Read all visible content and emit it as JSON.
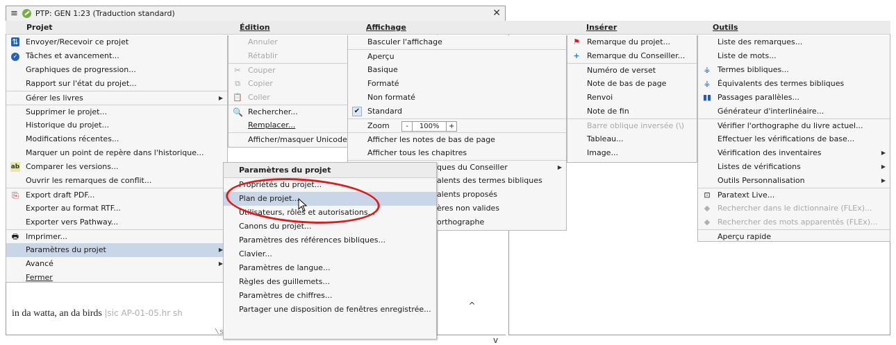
{
  "window": {
    "title": "PTP: GEN 1:23 (Traduction standard)",
    "close_glyph": "✕",
    "document_text": "in da watta, an da birds",
    "document_ref": "|sic  AP-01-05.hr  sh",
    "marker_text": "\\s2 [",
    "scroll_up": "^",
    "scroll_down": "v"
  },
  "menubar": {
    "projet": "Projet",
    "edition": "Édition",
    "affichage": "Affichage",
    "inserer": "Insérer",
    "outils": "Outils"
  },
  "projet_menu": [
    {
      "label": "Envoyer/Recevoir ce projet",
      "icon": "send-receive-icon"
    },
    {
      "label": "Tâches et avancement...",
      "icon": "tasks-icon"
    },
    {
      "label": "Graphiques de progression..."
    },
    {
      "label": "Rapport sur l'état du projet..."
    },
    {
      "label": "Gérer les livres",
      "submenu": true
    },
    {
      "label": "Supprimer le projet..."
    },
    {
      "label": "Historique du projet..."
    },
    {
      "label": "Modifications récentes..."
    },
    {
      "label": "Marquer un point de repère dans l'historique..."
    },
    {
      "label": "Comparer les versions...",
      "icon": "compare-icon"
    },
    {
      "label": "Ouvrir les remarques de conflit..."
    },
    {
      "label": "Export draft PDF...",
      "icon": "pdf-icon"
    },
    {
      "label": "Exporter au format RTF..."
    },
    {
      "label": "Exporter vers Pathway..."
    },
    {
      "label": "Imprimer...",
      "icon": "printer-icon"
    },
    {
      "label": "Paramètres du projet",
      "submenu": true,
      "highlighted": true
    },
    {
      "label": "Avancé",
      "submenu": true
    },
    {
      "label": "Fermer"
    }
  ],
  "edition_menu": [
    {
      "label": "Annuler",
      "disabled": true
    },
    {
      "label": "Rétablir",
      "disabled": true
    },
    {
      "label": "Couper",
      "disabled": true,
      "icon": "scissors-icon"
    },
    {
      "label": "Copier",
      "disabled": true,
      "icon": "copy-icon"
    },
    {
      "label": "Coller",
      "disabled": true,
      "icon": "paste-icon"
    },
    {
      "label": "Rechercher...",
      "icon": "search-icon"
    },
    {
      "label": "Remplacer..."
    },
    {
      "label": "Afficher/masquer Unicode"
    }
  ],
  "affichage_menu": {
    "items_top": [
      {
        "label": "Basculer l'affichage"
      },
      {
        "label": "Aperçu"
      },
      {
        "label": "Basique"
      },
      {
        "label": "Formaté"
      },
      {
        "label": "Non formaté"
      },
      {
        "label": "Standard",
        "checked": true
      }
    ],
    "zoom_label": "Zoom",
    "zoom_minus": "-",
    "zoom_value": "100%",
    "zoom_plus": "+",
    "items_bottom": [
      {
        "label": "Afficher les notes de bas de page"
      },
      {
        "label": "Afficher tous les chapitres"
      },
      {
        "label": "ques du Conseiller",
        "submenu": true
      },
      {
        "label": "alents des termes bibliques"
      },
      {
        "label": "alents proposés"
      },
      {
        "label": "ères non valides"
      },
      {
        "label": "orthographe"
      }
    ]
  },
  "inserer_menu": [
    {
      "label": "Remarque du projet...",
      "icon": "red-flag-icon"
    },
    {
      "label": "Remarque du Conseiller...",
      "icon": "blue-cross-icon"
    },
    {
      "label": "Numéro de verset"
    },
    {
      "label": "Note de bas de page"
    },
    {
      "label": "Renvoi"
    },
    {
      "label": "Note de fin"
    },
    {
      "label": "Barre oblique inversée (\\)",
      "disabled": true
    },
    {
      "label": "Tableau..."
    },
    {
      "label": "Image..."
    }
  ],
  "outils_menu": [
    {
      "label": "Liste des remarques..."
    },
    {
      "label": "Liste de mots..."
    },
    {
      "label": "Termes bibliques...",
      "icon": "biblical-terms-icon"
    },
    {
      "label": "Équivalents des termes bibliques",
      "icon": "biblical-terms-icon"
    },
    {
      "label": "Passages parallèles...",
      "icon": "parallel-passages-icon"
    },
    {
      "label": "Générateur d'interlinéaire..."
    },
    {
      "label": "Vérifier l'orthographe du livre actuel..."
    },
    {
      "label": "Effectuer les vérifications de base..."
    },
    {
      "label": "Vérification des inventaires",
      "submenu": true
    },
    {
      "label": "Listes de vérifications",
      "submenu": true
    },
    {
      "label": "Outils Personnalisation",
      "submenu": true
    },
    {
      "label": "Paratext Live...",
      "icon": "paratext-live-icon"
    },
    {
      "label": "Rechercher dans le dictionnaire (FLEx)...",
      "disabled": true,
      "icon": "flex-icon"
    },
    {
      "label": "Rechercher des mots apparentés (FLEx)...",
      "disabled": true,
      "icon": "flex-icon"
    },
    {
      "label": "Aperçu rapide"
    }
  ],
  "parametres_submenu": {
    "header": "Paramètres du projet",
    "items": [
      {
        "label": "Propriétés du projet..."
      },
      {
        "label": "Plan de projet...",
        "highlighted": true
      },
      {
        "label": "Utilisateurs, rôles et autorisations..."
      },
      {
        "label": "Canons du projet..."
      },
      {
        "label": "Paramètres des références bibliques..."
      },
      {
        "label": "Clavier..."
      },
      {
        "label": "Paramètres de langue..."
      },
      {
        "label": "Règles des guillemets..."
      },
      {
        "label": "Paramètres de chiffres..."
      },
      {
        "label": "Partager une disposition de fenêtres enregistrée..."
      }
    ]
  },
  "colors": {
    "highlight": "#c9d6e8",
    "annotation_red": "#e01b1b",
    "menu_bg": "#f6f6f6"
  }
}
